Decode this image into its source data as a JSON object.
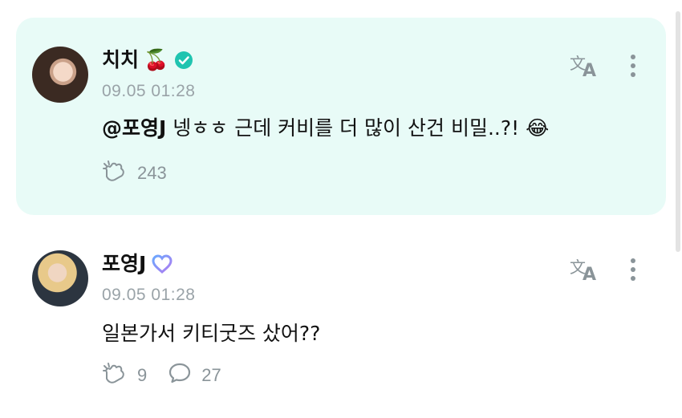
{
  "posts": [
    {
      "author": "치치",
      "author_emoji": "🍒",
      "badge_icon": "verified-check-icon",
      "badge_color": "#20c4b0",
      "time": "09.05 01:28",
      "mention": "@포영J",
      "text": " 넹ㅎㅎ 근데 커비를 더 많이 산건 비밀..?! 😂",
      "likes": "243",
      "like_icon": "cheer-hand-icon",
      "highlight_bg": "#e8fbf7"
    },
    {
      "author": "포영J",
      "badge_icon": "heart-badge-icon",
      "badge_color": "#8b7ff0",
      "time": "09.05 01:28",
      "text": "일본가서 키티굿즈 샀어??",
      "likes": "9",
      "comments": "27",
      "like_icon": "cheer-hand-icon",
      "comment_icon": "comment-bubble-icon"
    }
  ],
  "icons": {
    "translate": "translate-icon",
    "more": "more-vertical-icon"
  }
}
